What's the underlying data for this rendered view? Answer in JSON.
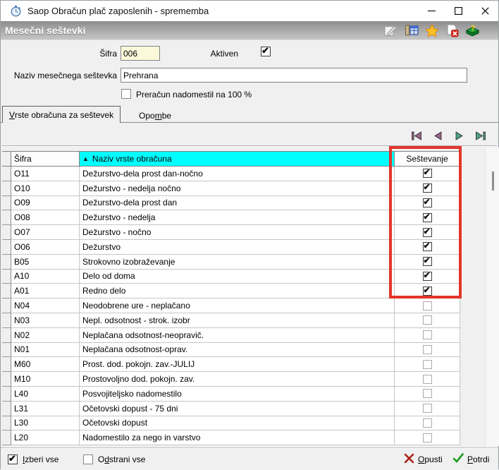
{
  "window": {
    "title": "Saop Obračun plač zaposlenih - sprememba",
    "icon": "stopwatch-app-icon",
    "controls": [
      "minimize",
      "maximize",
      "close"
    ]
  },
  "header": {
    "title": "Mesečni seštevki",
    "icons": [
      "edit-note-icon",
      "column-settings-icon",
      "favorite-star-icon",
      "delete-record-icon",
      "help-book-icon"
    ]
  },
  "form": {
    "sifra_label": "Šifra",
    "sifra_value": "006",
    "aktiven_label": "Aktiven",
    "aktiven_checked": true,
    "naziv_label": "Naziv mesečnega seštevka",
    "naziv_value": "Prehrana",
    "preracun_label": "Preračun nadomestil na 100 %",
    "preracun_checked": false
  },
  "tabs": [
    {
      "label": {
        "text": "Vrste obračuna za seštevek",
        "ak": 0
      },
      "active": true
    },
    {
      "label": {
        "text": "Opombe",
        "ak": 3
      },
      "active": false
    }
  ],
  "nav": [
    "first-record",
    "previous-record",
    "next-record",
    "last-record"
  ],
  "table": {
    "columns": [
      "Šifra",
      "Naziv vrste obračuna",
      "Seštevanje"
    ],
    "sorted_column": "Naziv vrste obračuna",
    "sort_direction": "ascending",
    "rows": [
      {
        "code": "O11",
        "name": "Dežurstvo-dela prost dan-nočno",
        "checked": true
      },
      {
        "code": "O10",
        "name": "Dežurstvo - nedelja nočno",
        "checked": true
      },
      {
        "code": "O09",
        "name": "Dežurstvo-dela prost dan",
        "checked": true
      },
      {
        "code": "O08",
        "name": "Dežurstvo - nedelja",
        "checked": true
      },
      {
        "code": "O07",
        "name": "Dežurstvo - nočno",
        "checked": true
      },
      {
        "code": "O06",
        "name": "Dežurstvo",
        "checked": true
      },
      {
        "code": "B05",
        "name": "Strokovno izobraževanje",
        "checked": true
      },
      {
        "code": "A10",
        "name": "Delo od doma",
        "checked": true
      },
      {
        "code": "A01",
        "name": "Redno delo",
        "checked": true
      },
      {
        "code": "N04",
        "name": "Neodobrene ure - neplačano",
        "checked": false
      },
      {
        "code": "N03",
        "name": "Nepl. odsotnost - strok. izobr",
        "checked": false
      },
      {
        "code": "N02",
        "name": "Neplačana odsotnost-neopravič.",
        "checked": false
      },
      {
        "code": "N01",
        "name": "Neplačana odsotnost-oprav.",
        "checked": false
      },
      {
        "code": "M60",
        "name": "Prost. dod. pokojn. zav.-JULIJ",
        "checked": false
      },
      {
        "code": "M10",
        "name": "Prostovoljno dod. pokojn. zav.",
        "checked": false
      },
      {
        "code": "L40",
        "name": "Posvojiteljsko nadomestilo",
        "checked": false
      },
      {
        "code": "L31",
        "name": "Očetovski dopust - 75 dni",
        "checked": false
      },
      {
        "code": "L30",
        "name": "Očetovski dopust",
        "checked": false
      },
      {
        "code": "L20",
        "name": "Nadomestilo za nego in varstvo",
        "checked": false
      }
    ]
  },
  "footer": {
    "select_all": {
      "label": {
        "text": "Izberi vse",
        "ak": 0
      },
      "checked": true
    },
    "remove_all": {
      "label": {
        "text": "Odstrani vse",
        "ak": 1
      },
      "checked": false
    },
    "cancel": {
      "label": {
        "text": "Opusti",
        "ak": 0
      }
    },
    "confirm": {
      "label": {
        "text": "Potrdi",
        "ak": 0
      }
    }
  },
  "annotation": {
    "shape": "rectangle",
    "color": "#e3352b",
    "highlights": "Seštevanje column checked rows"
  }
}
